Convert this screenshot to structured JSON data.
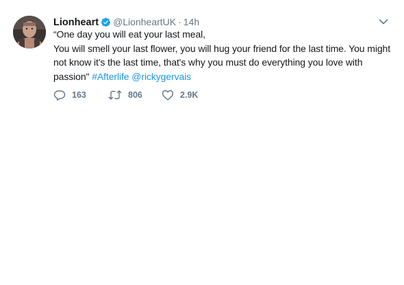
{
  "tweet": {
    "display_name": "Lionheart",
    "handle": "@LionheartUK",
    "separator": "·",
    "time": "14h",
    "verified": true,
    "text_lines": [
      "“One day you will eat your last meal,",
      "You will smell your last flower, you will hug your friend for the last time. You might",
      "not know it's the last time, that's why you must do everything you love with"
    ],
    "last_line_prefix": "passion\" ",
    "hashtag": "#Afterlife",
    "mention": "@rickygervais",
    "actions": {
      "reply_count": "163",
      "retweet_count": "806",
      "like_count": "2.9K"
    },
    "icons": {
      "avatar": "avatar-photo",
      "verified": "verified-badge-icon",
      "menu": "chevron-down-icon",
      "reply": "reply-icon",
      "retweet": "retweet-icon",
      "like": "heart-icon"
    }
  },
  "colors": {
    "text": "#14171a",
    "secondary": "#657786",
    "link": "#1b95e0",
    "verified": "#1da1f2"
  }
}
